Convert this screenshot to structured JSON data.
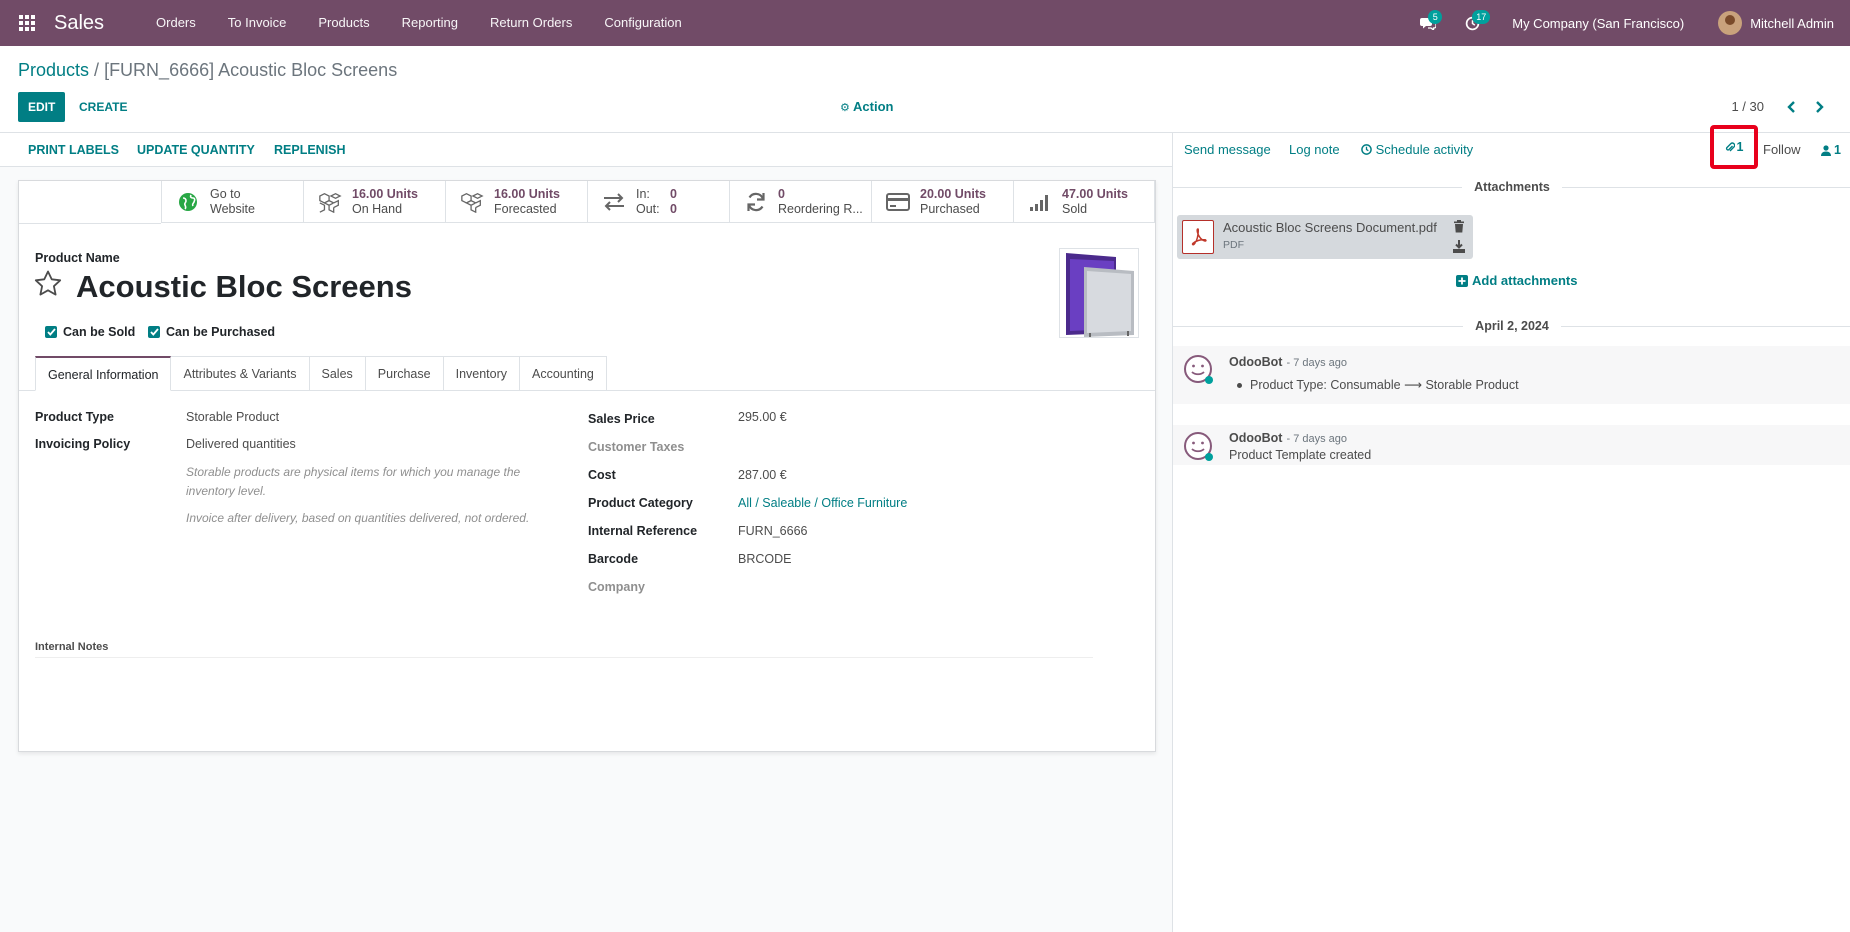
{
  "navbar": {
    "brand": "Sales",
    "menu": [
      "Orders",
      "To Invoice",
      "Products",
      "Reporting",
      "Return Orders",
      "Configuration"
    ],
    "messages_count": "5",
    "activities_count": "17",
    "company": "My Company (San Francisco)",
    "user": "Mitchell Admin"
  },
  "breadcrumb": {
    "parent": "Products",
    "separator": " / ",
    "current": "[FURN_6666] Acoustic Bloc Screens"
  },
  "toolbar": {
    "edit": "EDIT",
    "create": "CREATE",
    "action": "Action",
    "pager": "1 / 30"
  },
  "statusbar": {
    "buttons": [
      "PRINT LABELS",
      "UPDATE QUANTITY",
      "REPLENISH"
    ]
  },
  "stat_buttons": {
    "website": {
      "line1": "Go to",
      "line2": "Website"
    },
    "on_hand": {
      "value": "16.00 Units",
      "label": "On Hand"
    },
    "forecasted": {
      "value": "16.00 Units",
      "label": "Forecasted"
    },
    "inout": {
      "in_label": "In:",
      "in_value": "0",
      "out_label": "Out:",
      "out_value": "0"
    },
    "reordering": {
      "value": "0",
      "label": "Reordering R..."
    },
    "purchased": {
      "value": "20.00 Units",
      "label": "Purchased"
    },
    "sold": {
      "value": "47.00 Units",
      "label": "Sold"
    }
  },
  "product": {
    "name_label": "Product Name",
    "name": "Acoustic Bloc Screens",
    "can_be_sold": "Can be Sold",
    "can_be_purchased": "Can be Purchased"
  },
  "tabs": [
    "General Information",
    "Attributes & Variants",
    "Sales",
    "Purchase",
    "Inventory",
    "Accounting"
  ],
  "general": {
    "product_type_label": "Product Type",
    "product_type": "Storable Product",
    "invoicing_policy_label": "Invoicing Policy",
    "invoicing_policy": "Delivered quantities",
    "help_storable": "Storable products are physical items for which you manage the inventory level.",
    "help_invoice": "Invoice after delivery, based on quantities delivered, not ordered.",
    "sales_price_label": "Sales Price",
    "sales_price": "295.00 €",
    "customer_taxes_label": "Customer Taxes",
    "cost_label": "Cost",
    "cost": "287.00 €",
    "category_label": "Product Category",
    "category": "All / Saleable / Office Furniture",
    "internal_ref_label": "Internal Reference",
    "internal_ref": "FURN_6666",
    "barcode_label": "Barcode",
    "barcode": "BRCODE",
    "company_label": "Company",
    "internal_notes_label": "Internal Notes"
  },
  "chatter": {
    "send_message": "Send message",
    "log_note": "Log note",
    "schedule_activity": "Schedule activity",
    "attachment_count": "1",
    "follow": "Follow",
    "followers_count": "1",
    "attachments_title": "Attachments",
    "attachment": {
      "name": "Acoustic Bloc Screens Document.pdf",
      "type": "PDF"
    },
    "add_attachments": "Add attachments",
    "date_separator": "April 2, 2024",
    "messages": [
      {
        "author": "OdooBot",
        "date": "- 7 days ago",
        "body_from": "Product Type: Consumable",
        "body_to": "Storable Product"
      },
      {
        "author": "OdooBot",
        "date": "- 7 days ago",
        "body": "Product Template created"
      }
    ]
  },
  "colors": {
    "brand": "#714b67",
    "accent": "#017e84",
    "highlight_box": "#e8001c"
  }
}
